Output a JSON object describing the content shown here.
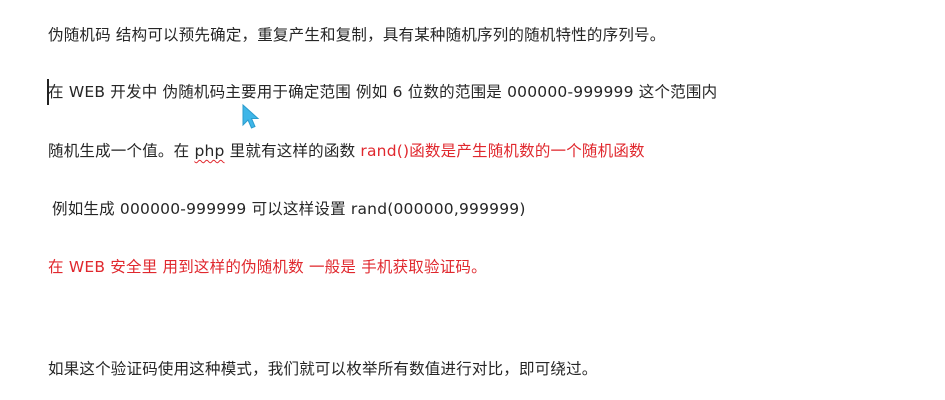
{
  "document": {
    "line1": "伪随机码 结构可以预先确定，重复产生和复制，具有某种随机序列的随机特性的序列号。",
    "line2": "在 WEB 开发中 伪随机码主要用于确定范围  例如 6 位数的范围是  000000-999999  这个范围内",
    "line3_a": "随机生成一个值。在 ",
    "line3_php": "php",
    "line3_b": " 里就有这样的函数  ",
    "line3_red": "rand()函数是产生随机数的一个随机函数",
    "line4": "例如生成 000000-999999  可以这样设置  rand(000000,999999)",
    "line5_red": "在 WEB 安全里 用到这样的伪随机数  一般是  手机获取验证码。",
    "line6": "如果这个验证码使用这种模式，我们就可以枚举所有数值进行对比，即可绕过。"
  },
  "icons": {
    "cursor": "mouse-pointer-icon",
    "caret": "text-caret"
  },
  "colors": {
    "text": "#262626",
    "highlight_red": "#e0282e",
    "pointer": "#3fb6e8"
  }
}
